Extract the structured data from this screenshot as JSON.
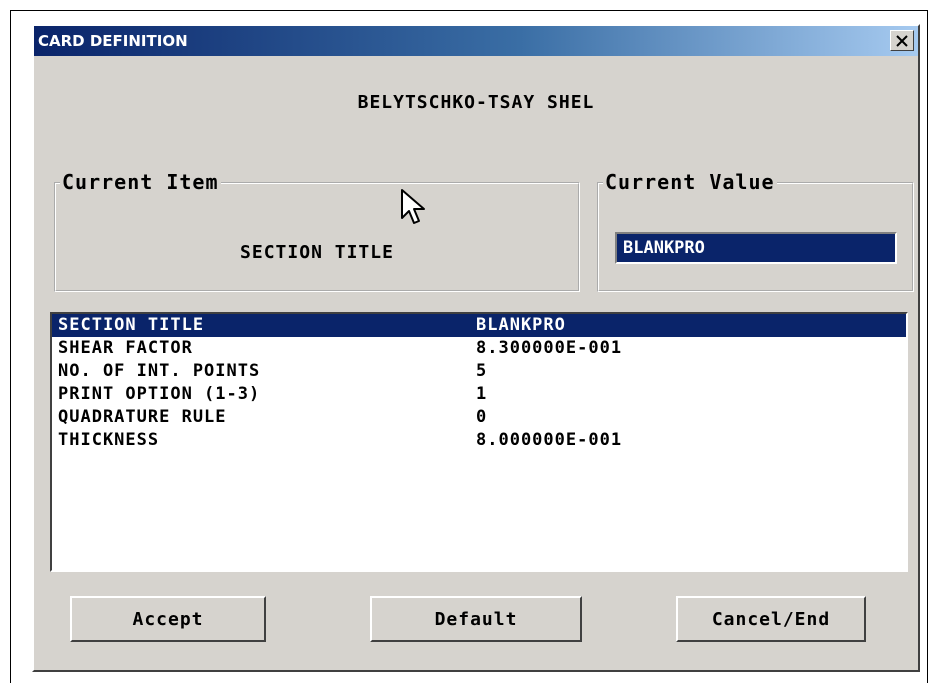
{
  "window": {
    "title": "CARD DEFINITION",
    "close_label": "×"
  },
  "header": {
    "text": "BELYTSCHKO-TSAY SHEL"
  },
  "current_item": {
    "legend": "Current Item",
    "value": "SECTION TITLE"
  },
  "current_value": {
    "legend": "Current Value",
    "value": "BLANKPRO"
  },
  "list": {
    "selected_index": 0,
    "rows": [
      {
        "name": "SECTION TITLE",
        "value": "BLANKPRO"
      },
      {
        "name": "SHEAR FACTOR",
        "value": "8.300000E-001"
      },
      {
        "name": "NO. OF INT. POINTS",
        "value": "5"
      },
      {
        "name": "PRINT OPTION (1-3)",
        "value": "1"
      },
      {
        "name": "QUADRATURE RULE",
        "value": "0"
      },
      {
        "name": "THICKNESS",
        "value": "8.000000E-001"
      }
    ]
  },
  "buttons": {
    "accept": "Accept",
    "default": "Default",
    "cancel": "Cancel/End"
  },
  "colors": {
    "window_bg": "#d6d3ce",
    "selection": "#0a246a",
    "title_gradient_start": "#0a246a",
    "title_gradient_end": "#a6caf0"
  },
  "icons": {
    "close": "close-icon",
    "cursor": "mouse-pointer-icon"
  }
}
